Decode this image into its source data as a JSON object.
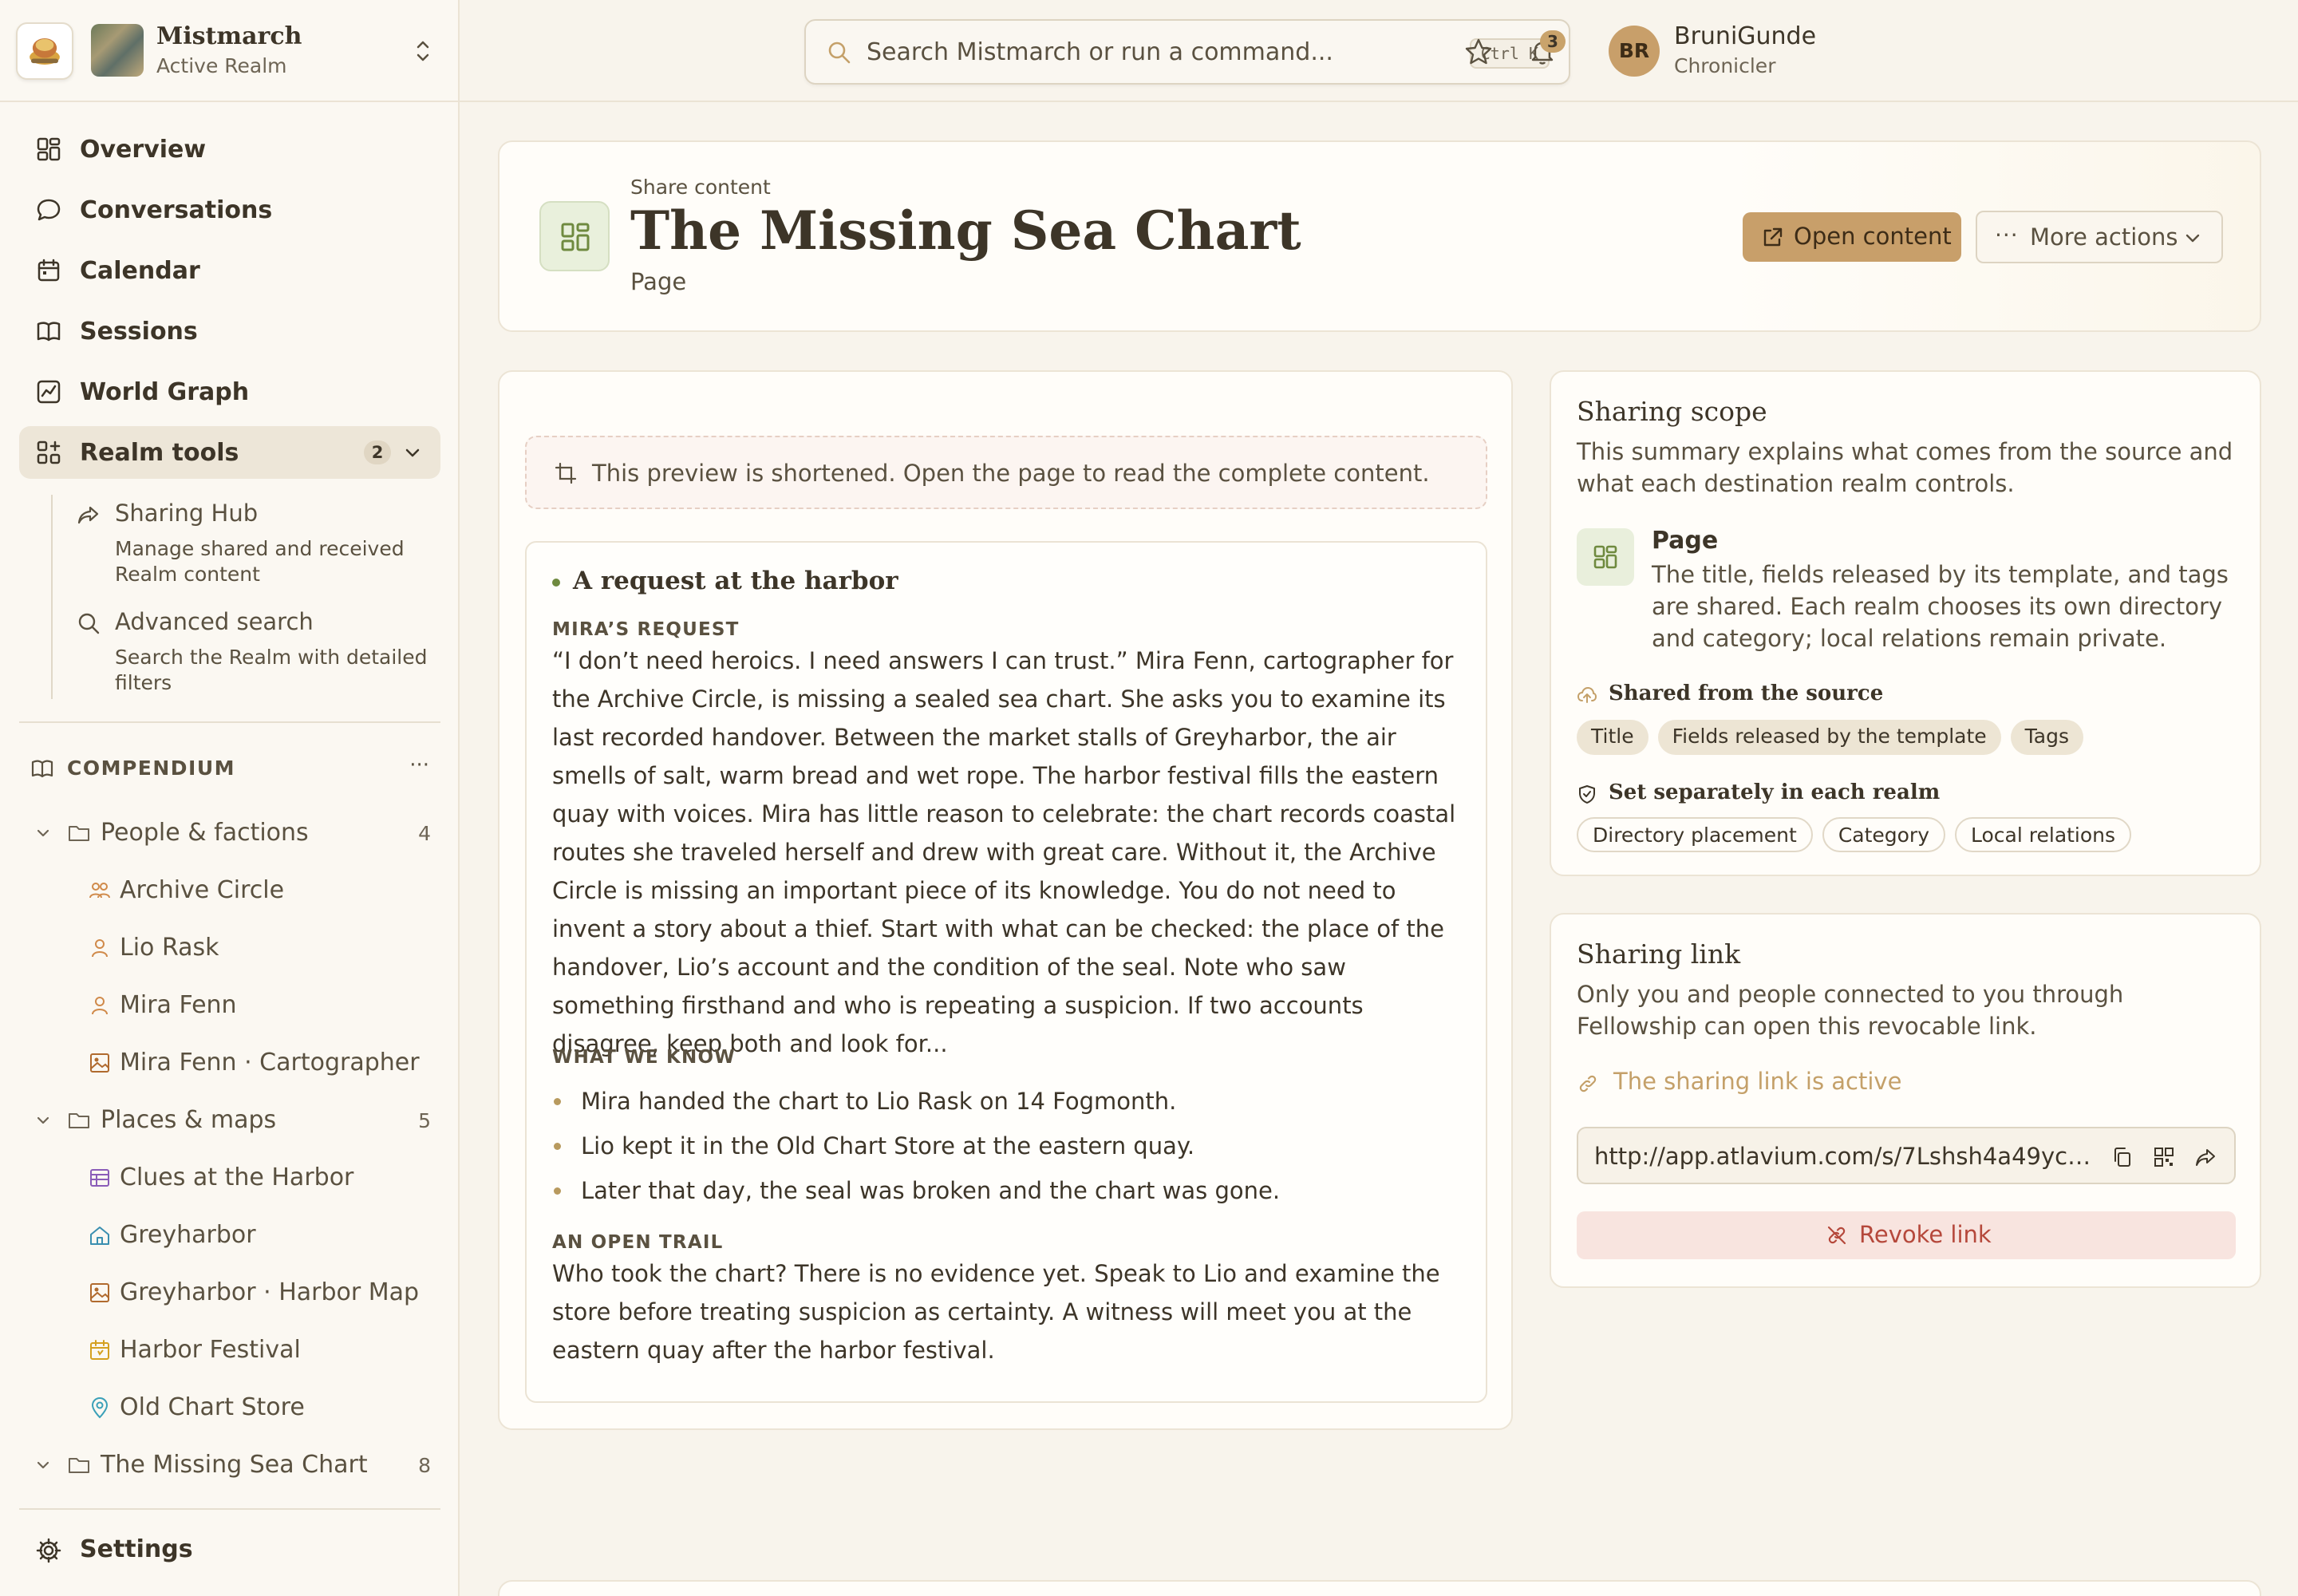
{
  "realm": {
    "name": "Mistmarch",
    "status": "Active Realm"
  },
  "nav": {
    "items": [
      {
        "label": "Overview",
        "icon": "dashboard-icon"
      },
      {
        "label": "Conversations",
        "icon": "chat-bubble-icon"
      },
      {
        "label": "Calendar",
        "icon": "calendar-icon"
      },
      {
        "label": "Sessions",
        "icon": "book-open-icon"
      },
      {
        "label": "World Graph",
        "icon": "graph-icon"
      }
    ],
    "realm_tools": {
      "label": "Realm tools",
      "badge": "2",
      "icon": "tools-grid-icon"
    },
    "subitems": [
      {
        "title": "Sharing Hub",
        "desc": "Manage shared and received Realm content",
        "icon": "share-icon"
      },
      {
        "title": "Advanced search",
        "desc": "Search the Realm with detailed filters",
        "icon": "search-icon"
      }
    ],
    "settings": "Settings"
  },
  "compendium": {
    "title": "COMPENDIUM",
    "more": "···",
    "folders": [
      {
        "label": "People & factions",
        "count": "4",
        "items": [
          "Archive Circle",
          "Lio Rask",
          "Mira Fenn",
          "Mira Fenn · Cartographer"
        ]
      },
      {
        "label": "Places & maps",
        "count": "5",
        "items": [
          "Clues at the Harbor",
          "Greyharbor",
          "Greyharbor · Harbor Map",
          "Harbor Festival",
          "Old Chart Store"
        ]
      },
      {
        "label": "The Missing Sea Chart",
        "count": "8",
        "items": []
      }
    ]
  },
  "topbar": {
    "search_placeholder": "Search Mistmarch or run a command...",
    "shortcut": "Ctrl K",
    "notification_count": "3",
    "user": {
      "initials": "BR",
      "name": "BruniGunde",
      "role": "Chronicler"
    }
  },
  "header": {
    "kicker": "Share content",
    "title": "The Missing Sea Chart",
    "type": "Page",
    "open_button": "Open content",
    "more_button": "More actions"
  },
  "preview": {
    "notice": "This preview is shortened. Open the page to read the complete content.",
    "heading": "A request at the harbor",
    "sections": [
      {
        "label": "MIRA’S REQUEST",
        "text": "“I don’t need heroics. I need answers I can trust.” Mira Fenn, cartographer for the Archive Circle, is missing a sealed sea chart. She asks you to examine its last recorded handover. Between the market stalls of Greyharbor, the air smells of salt, warm bread and wet rope. The harbor festival fills the eastern quay with voices. Mira has little reason to celebrate: the chart records coastal routes she traveled herself and drew with great care. Without it, the Archive Circle is missing an important piece of its knowledge. You do not need to invent a story about a thief. Start with what can be checked: the place of the handover, Lio’s account and the condition of the seal. Note who saw something firsthand and who is repeating a suspicion. If two accounts disagree, keep both and look for..."
      },
      {
        "label": "WHAT WE KNOW",
        "facts": [
          "Mira handed the chart to Lio Rask on 14 Fogmonth.",
          "Lio kept it in the Old Chart Store at the eastern quay.",
          "Later that day, the seal was broken and the chart was gone."
        ]
      },
      {
        "label": "AN OPEN TRAIL",
        "text": "Who took the chart? There is no evidence yet. Speak to Lio and examine the store before treating suspicion as certainty. A witness will meet you at the eastern quay after the harbor festival."
      }
    ]
  },
  "scope": {
    "title": "Sharing scope",
    "desc": "This summary explains what comes from the source and what each destination realm controls.",
    "page_name": "Page",
    "page_desc": "The title, fields released by its template, and tags are shared. Each realm chooses its own directory and category; local relations remain private.",
    "shared_head": "Shared from the source",
    "shared_chips": [
      "Title",
      "Fields released by the template",
      "Tags"
    ],
    "separate_head": "Set separately in each realm",
    "separate_chips": [
      "Directory placement",
      "Category",
      "Local relations"
    ]
  },
  "link": {
    "title": "Sharing link",
    "desc": "Only you and people connected to you through Fellowship can open this revocable link.",
    "status": "The sharing link is active",
    "url": "http://app.atlavium.com/s/7Lshsh4a49ycq...",
    "revoke": "Revoke link"
  },
  "colors": {
    "accent": "#c89f6a",
    "background": "#f8f4ec",
    "danger": "#b5483b",
    "page_icon_green": "#6f8a3f"
  }
}
